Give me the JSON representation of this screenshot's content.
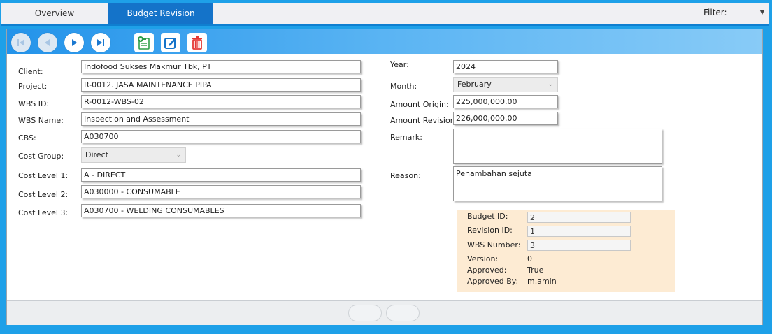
{
  "tabs": {
    "overview": "Overview",
    "budget_revision": "Budget Revision"
  },
  "filter": {
    "label": "Filter:"
  },
  "form": {
    "client": {
      "label": "Client:",
      "value": "Indofood Sukses Makmur Tbk, PT"
    },
    "project": {
      "label": "Project:",
      "value": "R-0012. JASA MAINTENANCE PIPA"
    },
    "wbs_id": {
      "label": "WBS ID:",
      "value": "R-0012-WBS-02"
    },
    "wbs_name": {
      "label": "WBS Name:",
      "value": "Inspection and Assessment"
    },
    "cbs": {
      "label": "CBS:",
      "value": "A030700"
    },
    "cost_group": {
      "label": "Cost Group:",
      "value": "Direct"
    },
    "cost_level_1": {
      "label": "Cost Level 1:",
      "value": "A - DIRECT"
    },
    "cost_level_2": {
      "label": "Cost Level 2:",
      "value": "A030000 - CONSUMABLE"
    },
    "cost_level_3": {
      "label": "Cost Level 3:",
      "value": "A030700 - WELDING CONSUMABLES"
    },
    "year": {
      "label": "Year:",
      "value": "2024"
    },
    "month": {
      "label": "Month:",
      "value": "February"
    },
    "amount_origin": {
      "label": "Amount Origin:",
      "value": "225,000,000.00"
    },
    "amount_revision": {
      "label": "Amount Revision",
      "value": "226,000,000.00"
    },
    "remark": {
      "label": "Remark:",
      "value": ""
    },
    "reason": {
      "label": "Reason:",
      "value": "Penambahan sejuta"
    }
  },
  "info": {
    "budget_id": {
      "label": "Budget ID:",
      "value": "2"
    },
    "revision_id": {
      "label": "Revision ID:",
      "value": "1"
    },
    "wbs_number": {
      "label": "WBS Number:",
      "value": "3"
    },
    "version": {
      "label": "Version:",
      "value": "0"
    },
    "approved": {
      "label": "Approved:",
      "value": "True"
    },
    "approved_by": {
      "label": "Approved By:",
      "value": "m.amin"
    }
  },
  "icons": {
    "first": "first-record-icon",
    "previous": "previous-record-icon",
    "next": "next-record-icon",
    "last": "last-record-icon",
    "add": "add-document-icon",
    "edit": "edit-icon",
    "delete": "trash-icon"
  },
  "colors": {
    "accent": "#1473c9",
    "info_bg": "#fdebd3",
    "delete": "#e53935",
    "add": "#2e9e48"
  }
}
